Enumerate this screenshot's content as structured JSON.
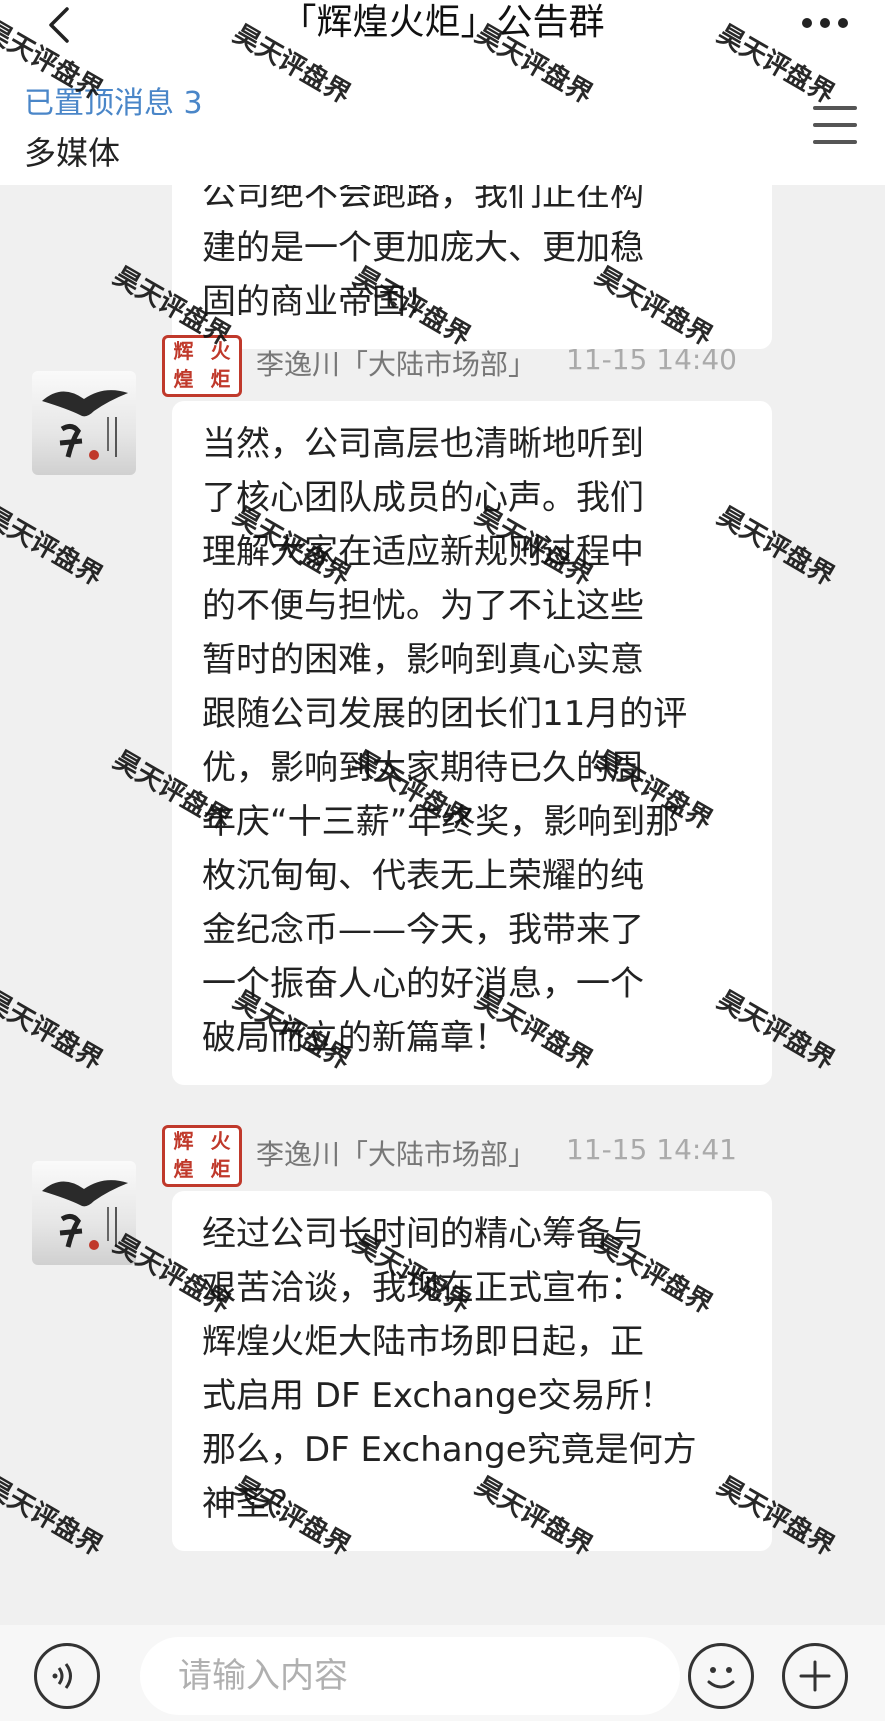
{
  "header": {
    "title": "「辉煌火炬」公告群",
    "pinned_label": "已置顶消息 3",
    "multimedia_label": "多媒体"
  },
  "messages": [
    {
      "lines": [
        "公司绝不会跑路，我们正在构",
        "建的是一个更加庞大、更加稳",
        "固的商业帝国！"
      ]
    },
    {
      "badge": [
        "辉",
        "火",
        "煌",
        "炬"
      ],
      "sender": "李逸川「大陆市场部」",
      "time": "11-15 14:40",
      "lines": [
        "当然，公司高层也清晰地听到",
        "了核心团队成员的心声。我们",
        "理解大家在适应新规则过程中",
        "的不便与担忧。为了不让这些",
        "暂时的困难，影响到真心实意",
        "跟随公司发展的团长们11月的评",
        "优，影响到大家期待已久的周",
        "年庆“十三薪”年终奖，影响到那",
        "枚沉甸甸、代表无上荣耀的纯",
        "金纪念币——今天，我带来了",
        "一个振奋人心的好消息，一个",
        "破局而立的新篇章！"
      ]
    },
    {
      "badge": [
        "辉",
        "火",
        "煌",
        "炬"
      ],
      "sender": "李逸川「大陆市场部」",
      "time": "11-15 14:41",
      "lines": [
        "经过公司长时间的精心筹备与",
        "艰苦洽谈，我现在正式宣布：",
        "辉煌火炬大陆市场即日起，正",
        "式启用 DF Exchange交易所！",
        "那么，DF Exchange究竟是何方",
        "神圣？"
      ]
    }
  ],
  "input": {
    "placeholder": "请输入内容"
  },
  "watermark": "昊天评盘界",
  "icons": [
    "back-icon",
    "more-icon",
    "list-icon",
    "voice-icon",
    "emoji-icon",
    "plus-icon"
  ],
  "colors": {
    "accent_blue": "#4a86c8",
    "badge_red": "#c0392b",
    "bubble_bg": "#ffffff",
    "chat_bg": "#f0f0f0"
  }
}
